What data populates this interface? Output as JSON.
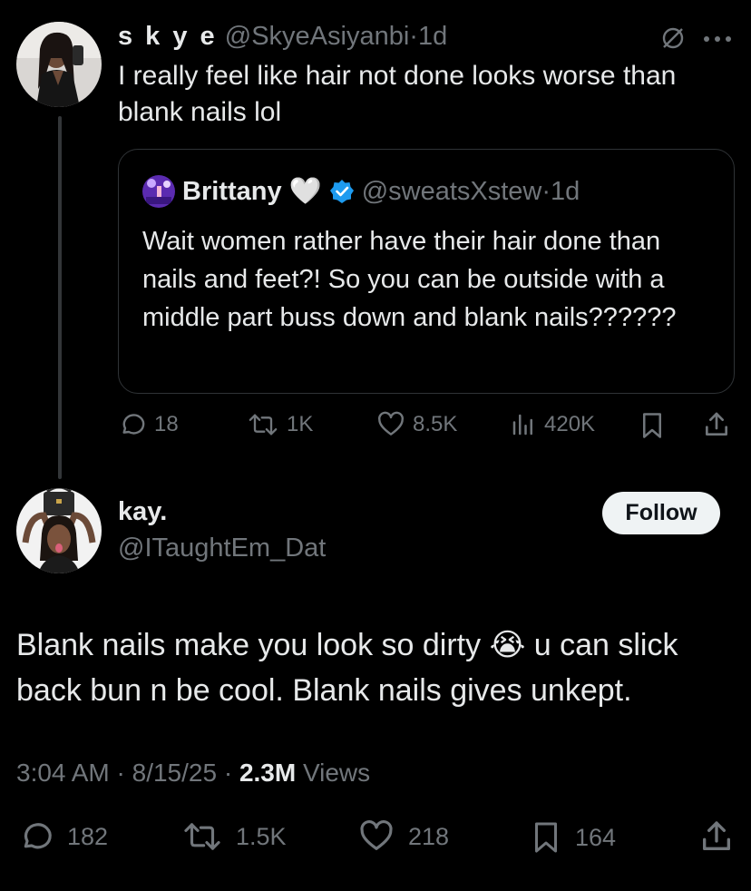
{
  "tweet1": {
    "display_name": "s k y e",
    "handle": "@SkyeAsiyanbi",
    "separator": "·",
    "time": "1d",
    "text": "I really feel like hair not done looks worse than blank nails lol",
    "quote": {
      "display_name": "Brittany",
      "heart_emoji": "🤍",
      "handle": "@sweatsXstew",
      "separator": "·",
      "time": "1d",
      "text": "Wait women rather have their hair done than nails and feet?! So you can be outside with a middle part buss down and blank nails??????"
    },
    "actions": {
      "replies": "18",
      "reposts": "1K",
      "likes": "8.5K",
      "views": "420K"
    }
  },
  "tweet2": {
    "display_name": "kay.",
    "handle": "@ITaughtEm_Dat",
    "follow_label": "Follow",
    "text_part1": "Blank nails make you look so dirty",
    "emoji": "😭",
    "text_part2": " u can slick back bun n be cool. Blank nails gives unkept.",
    "meta": {
      "time": "3:04 AM",
      "sep1": "·",
      "date": "8/15/25",
      "sep2": "·",
      "views_count": "2.3M",
      "views_label": "Views"
    },
    "actions": {
      "replies": "182",
      "reposts": "1.5K",
      "likes": "218",
      "bookmarks": "164"
    }
  },
  "colors": {
    "background": "#000000",
    "text": "#e7e9ea",
    "muted": "#71767b",
    "border": "#2f3336",
    "verified": "#1d9bf0",
    "follow_bg": "#eff3f4"
  }
}
